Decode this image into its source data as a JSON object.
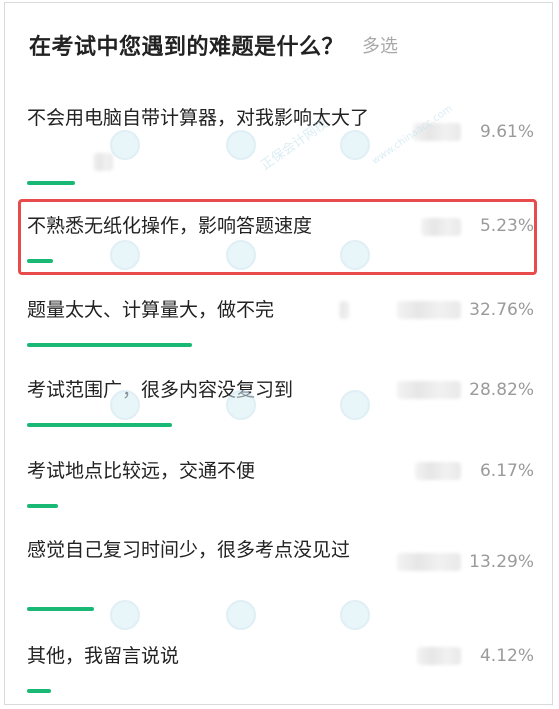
{
  "poll": {
    "title": "在考试中您遇到的难题是什么？",
    "type_label": "多选",
    "accent_color": "#19b874",
    "highlight_color": "#e84b4b",
    "options": [
      {
        "label": "不会用电脑自带计算器，对我影响太大了",
        "percent": "9.61%",
        "bar_fraction": 0.0961
      },
      {
        "label": "不熟悉无纸化操作，影响答题速度",
        "percent": "5.23%",
        "bar_fraction": 0.0523,
        "highlighted": true
      },
      {
        "label": "题量太大、计算量大，做不完",
        "percent": "32.76%",
        "bar_fraction": 0.3276
      },
      {
        "label": "考试范围广，很多内容没复习到",
        "percent": "28.82%",
        "bar_fraction": 0.2882
      },
      {
        "label": "考试地点比较远，交通不便",
        "percent": "6.17%",
        "bar_fraction": 0.0617
      },
      {
        "label": "感觉自己复习时间少，很多考点没见过",
        "percent": "13.29%",
        "bar_fraction": 0.1329
      },
      {
        "label": "其他，我留言说说",
        "percent": "4.12%",
        "bar_fraction": 0.0412
      }
    ]
  },
  "watermark": {
    "text": "正保会计网校",
    "subtext": "www.chinaacc.com"
  }
}
